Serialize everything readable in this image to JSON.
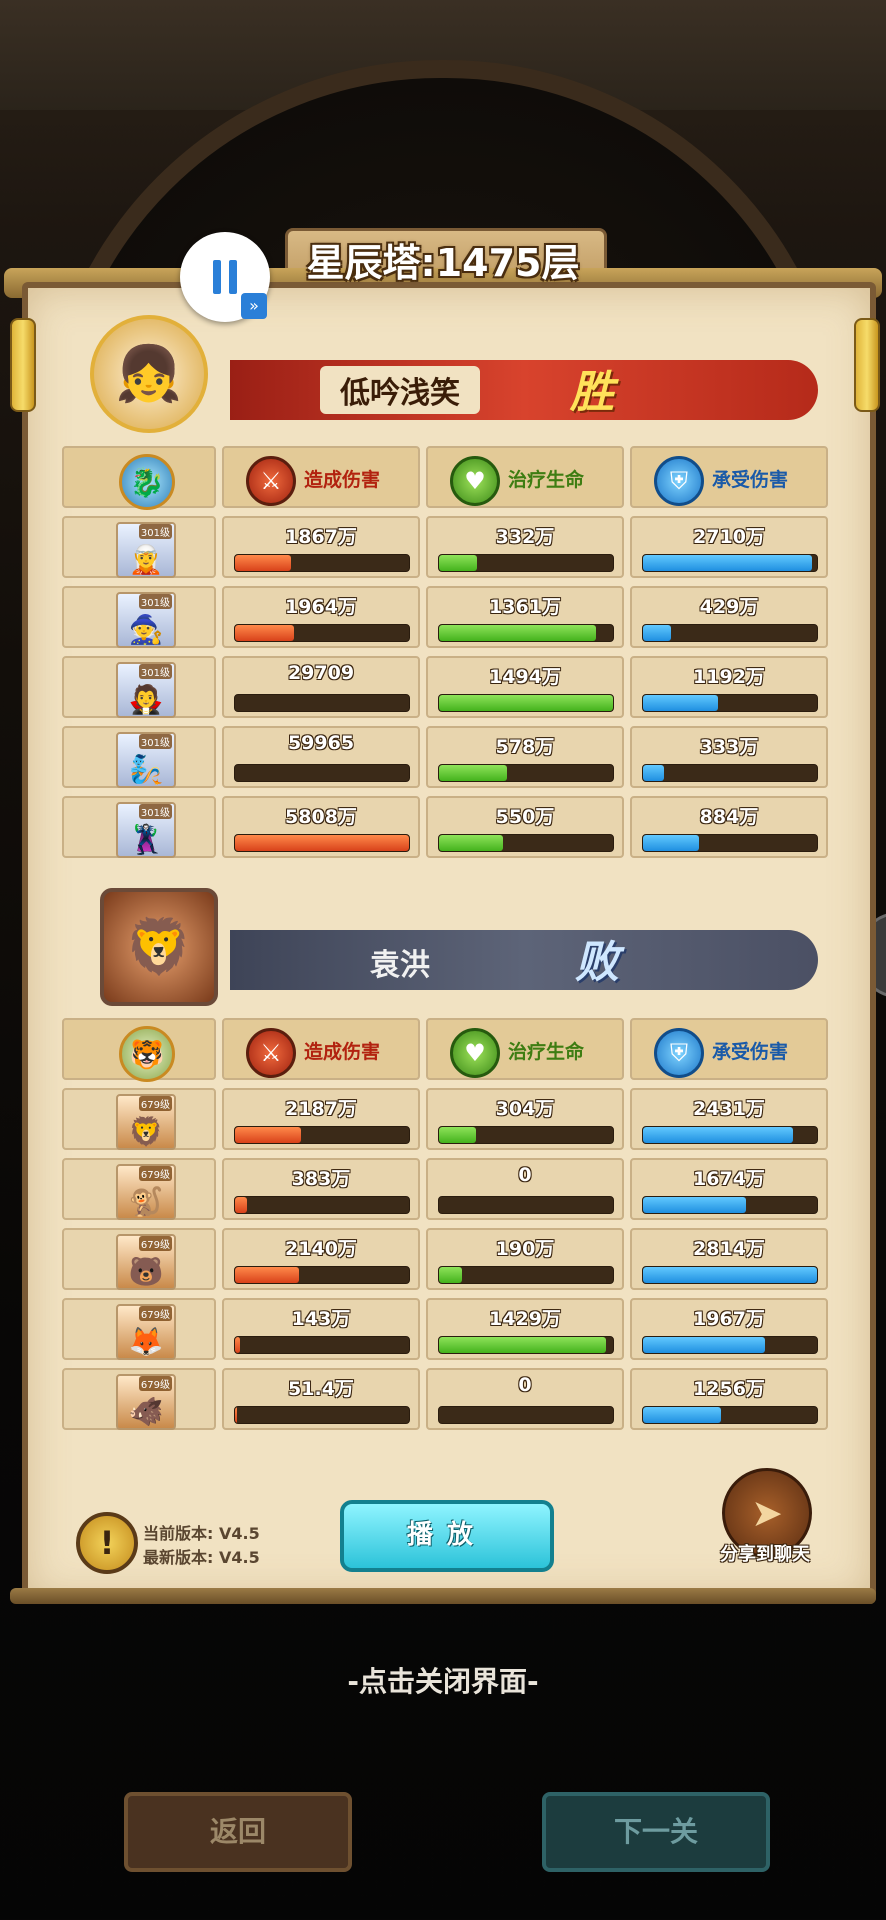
{
  "header": {
    "title": "星辰塔:1475层"
  },
  "controls": {
    "pause_icon": "pause-icon",
    "fast_forward_icon": "fast-forward-icon"
  },
  "columns": {
    "damage": "造成伤害",
    "heal": "治疗生命",
    "taken": "承受伤害"
  },
  "teams": [
    {
      "name": "低吟浅笑",
      "result": "胜",
      "heroes": [
        {
          "level": "301级",
          "damage": "1867万",
          "damage_pct": 0.32,
          "heal": "332万",
          "heal_pct": 0.22,
          "taken": "2710万",
          "taken_pct": 0.97
        },
        {
          "level": "301级",
          "damage": "1964万",
          "damage_pct": 0.34,
          "heal": "1361万",
          "heal_pct": 0.9,
          "taken": "429万",
          "taken_pct": 0.16
        },
        {
          "level": "301级",
          "damage": "29709",
          "damage_pct": 0.0,
          "heal": "1494万",
          "heal_pct": 1.0,
          "taken": "1192万",
          "taken_pct": 0.43
        },
        {
          "level": "301级",
          "damage": "59965",
          "damage_pct": 0.0,
          "heal": "578万",
          "heal_pct": 0.39,
          "taken": "333万",
          "taken_pct": 0.12
        },
        {
          "level": "301级",
          "damage": "5808万",
          "damage_pct": 1.0,
          "heal": "550万",
          "heal_pct": 0.37,
          "taken": "884万",
          "taken_pct": 0.32
        }
      ]
    },
    {
      "name": "袁洪",
      "result": "败",
      "heroes": [
        {
          "level": "679级",
          "damage": "2187万",
          "damage_pct": 0.38,
          "heal": "304万",
          "heal_pct": 0.21,
          "taken": "2431万",
          "taken_pct": 0.86
        },
        {
          "level": "679级",
          "damage": "383万",
          "damage_pct": 0.07,
          "heal": "0",
          "heal_pct": 0.0,
          "taken": "1674万",
          "taken_pct": 0.59
        },
        {
          "level": "679级",
          "damage": "2140万",
          "damage_pct": 0.37,
          "heal": "190万",
          "heal_pct": 0.13,
          "taken": "2814万",
          "taken_pct": 1.0
        },
        {
          "level": "679级",
          "damage": "143万",
          "damage_pct": 0.03,
          "heal": "1429万",
          "heal_pct": 0.96,
          "taken": "1967万",
          "taken_pct": 0.7
        },
        {
          "level": "679级",
          "damage": "51.4万",
          "damage_pct": 0.01,
          "heal": "0",
          "heal_pct": 0.0,
          "taken": "1256万",
          "taken_pct": 0.45
        }
      ]
    }
  ],
  "footer": {
    "current_version": "当前版本: V4.5",
    "latest_version": "最新版本: V4.5",
    "play_label": "播放",
    "share_label": "分享到聊天",
    "close_hint": "-点击关闭界面-",
    "back_label": "返回",
    "next_label": "下一关"
  },
  "colors": {
    "damage": "#d8421a",
    "heal": "#44b21d",
    "taken": "#1f8fe0",
    "play": "#2cc3d9"
  }
}
